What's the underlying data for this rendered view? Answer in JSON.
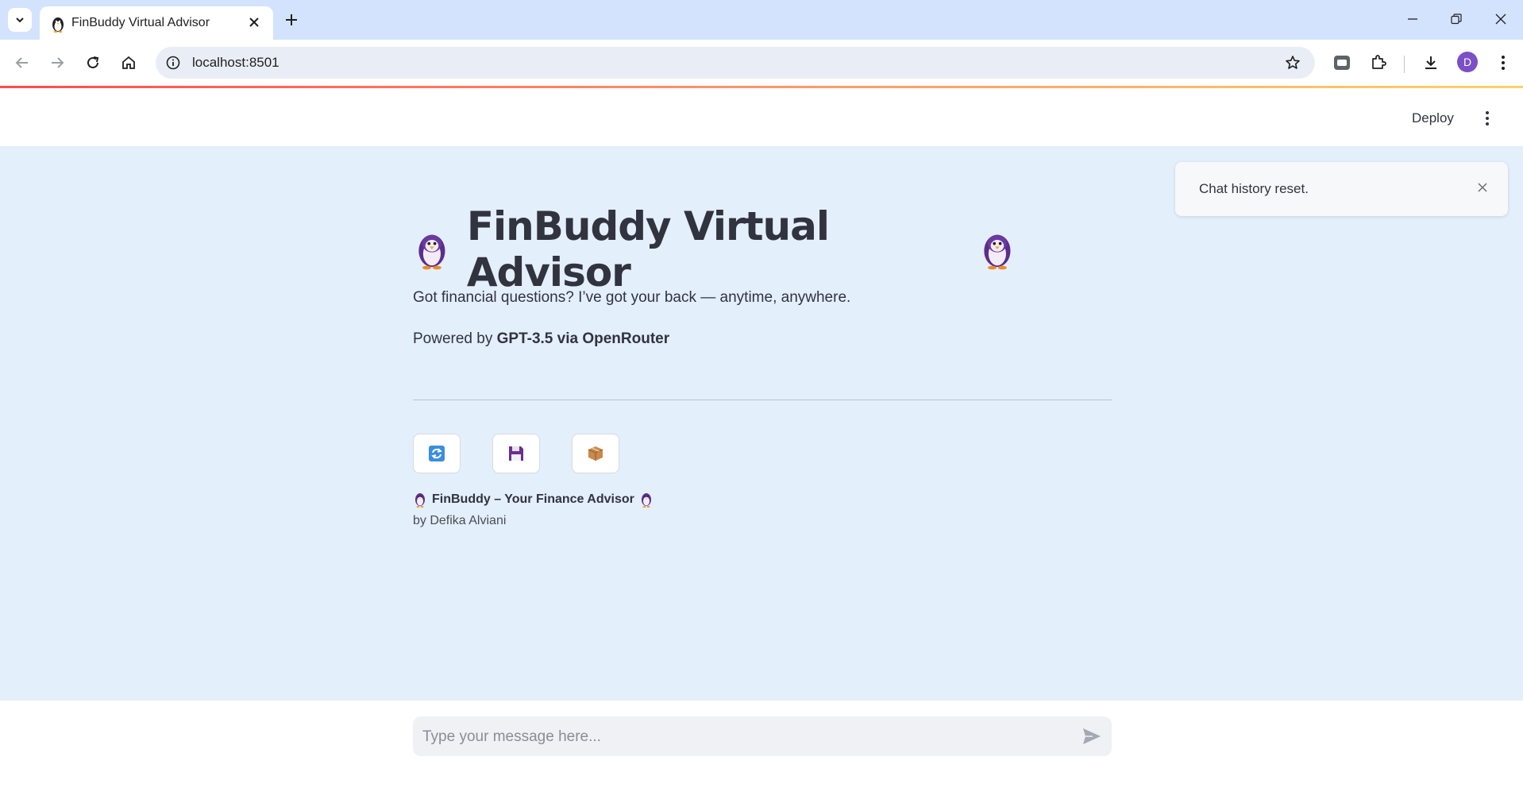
{
  "browser": {
    "tab_title": "FinBuddy Virtual Advisor",
    "url": "localhost:8501",
    "profile_initial": "D"
  },
  "app": {
    "deploy_label": "Deploy",
    "title": "FinBuddy Virtual Advisor",
    "intro": "Got financial questions? I’ve got your back — anytime, anywhere.",
    "powered_prefix": "Powered by ",
    "powered_model": "GPT-3.5 via OpenRouter",
    "action_buttons": [
      {
        "icon": "reset-icon"
      },
      {
        "icon": "save-icon"
      },
      {
        "icon": "archive-icon"
      }
    ],
    "footer_title": "FinBuddy – Your Finance Advisor",
    "footer_by": "by Defika Alviani",
    "toast": "Chat history reset.",
    "chat_placeholder": "Type your message here..."
  },
  "colors": {
    "main_bg": "#e3effb",
    "text": "#31333f",
    "accent_red": "#ff4b4b"
  }
}
